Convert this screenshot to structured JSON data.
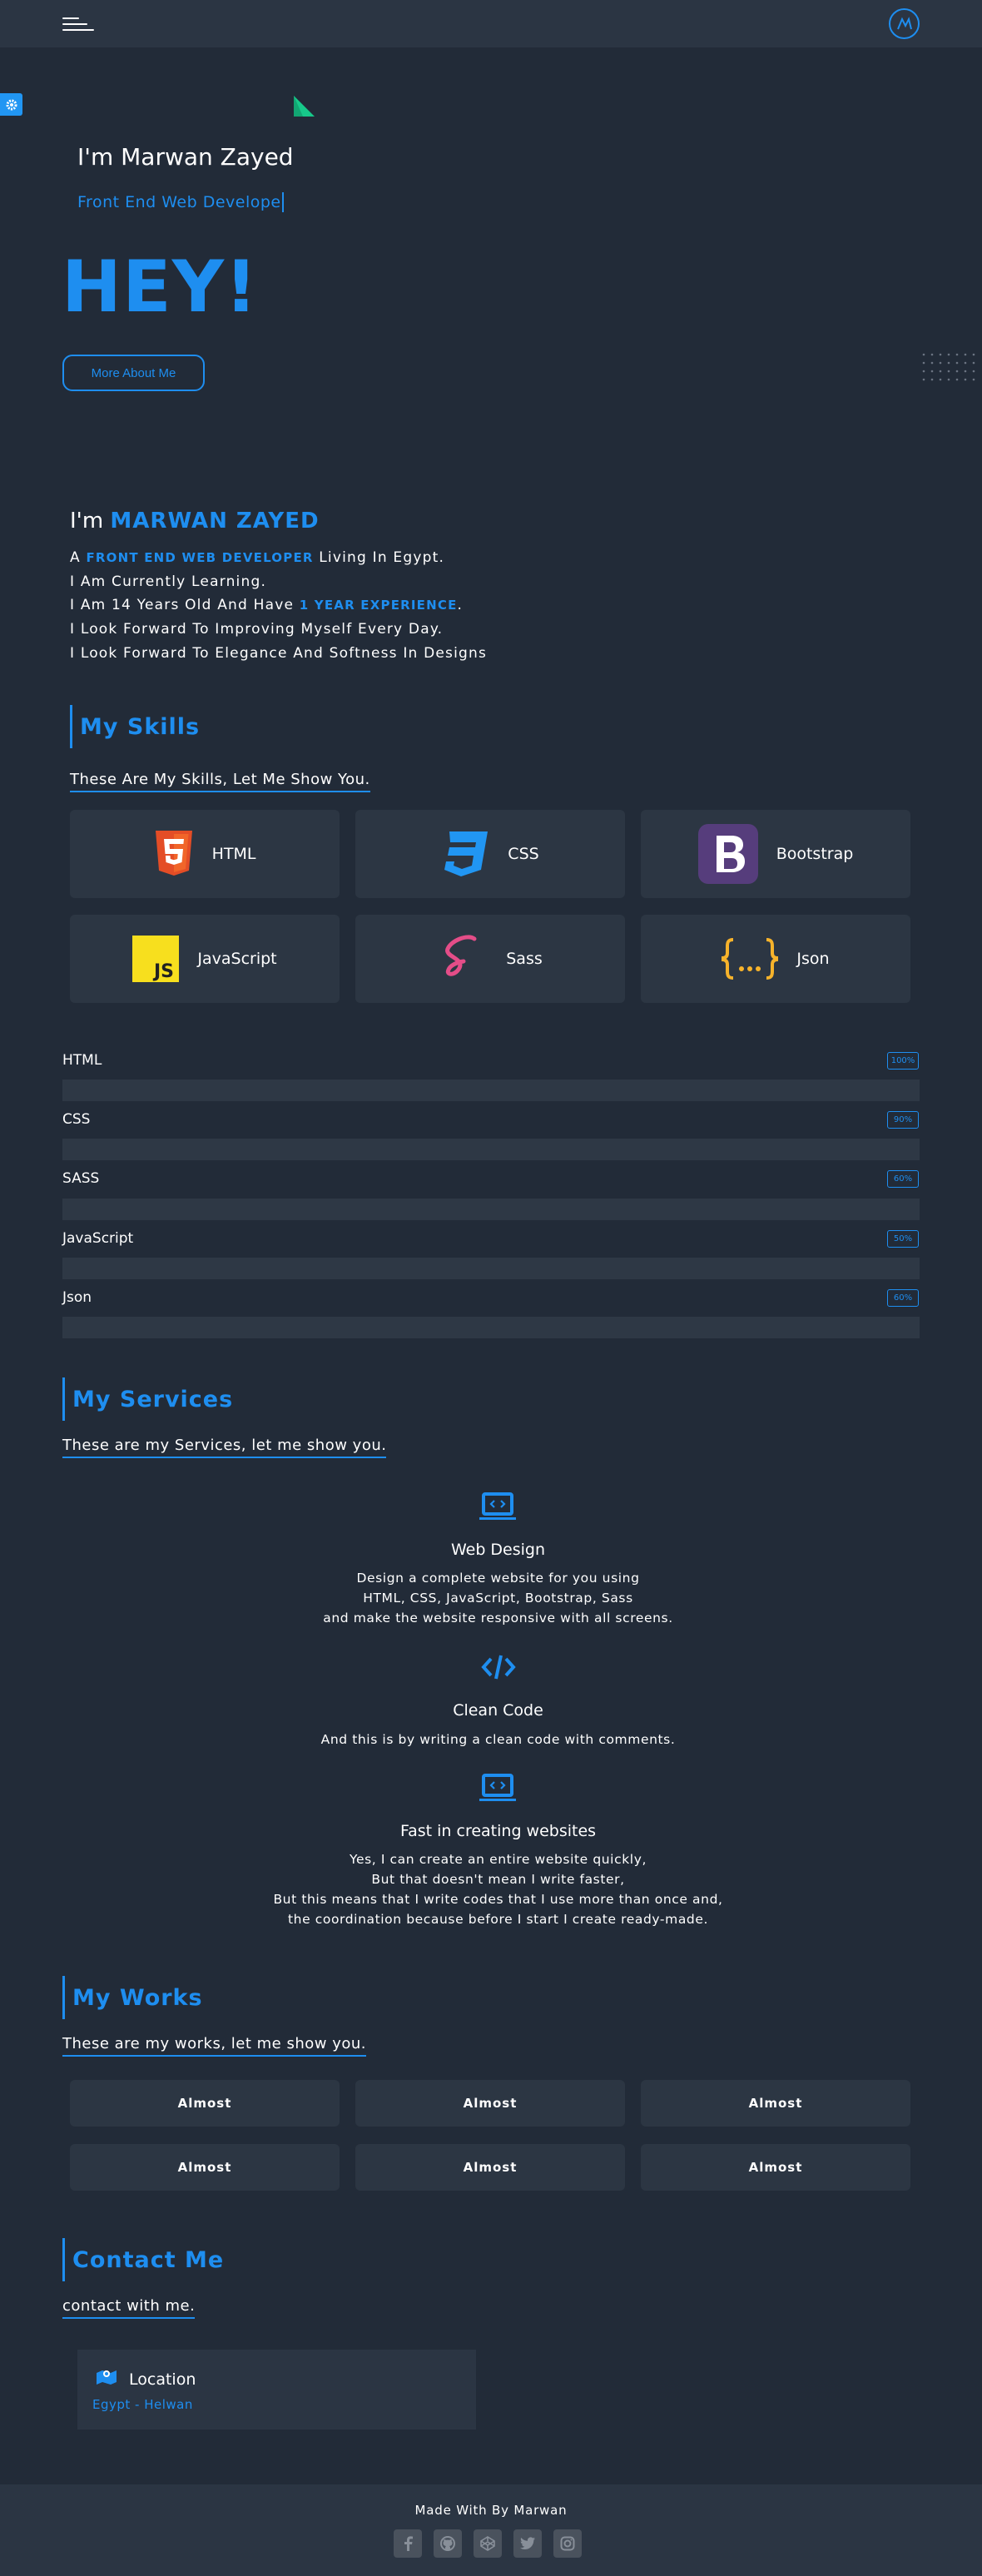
{
  "hero": {
    "greeting": "I'm Marwan Zayed",
    "typed_role": "Front End Web Develope",
    "hey": "HEY!",
    "more_button": "More About Me"
  },
  "about": {
    "prefix": "I'm",
    "name": "MARWAN ZAYED",
    "line1_a": "A",
    "line1_role": "FRONT END WEB DEVELOPER",
    "line1_b": "Living In Egypt.",
    "line2": "I Am Currently Learning.",
    "line3_a": "I Am 14 Years Old And Have",
    "line3_exp": "1 YEAR EXPERIENCE",
    "line3_b": ".",
    "line4": "I Look Forward To Improving Myself Every Day.",
    "line5": "I Look Forward To Elegance And Softness In Designs"
  },
  "skills": {
    "title": "My Skills",
    "subtitle": "These Are My Skills, Let Me Show You.",
    "cards": [
      {
        "label": "HTML",
        "icon": "html5-icon",
        "color": "#e44d26"
      },
      {
        "label": "CSS",
        "icon": "css3-icon",
        "color": "#2196f3"
      },
      {
        "label": "Bootstrap",
        "icon": "bootstrap-icon",
        "color": "#563d7c"
      },
      {
        "label": "JavaScript",
        "icon": "js-icon",
        "color": "#f7df1e"
      },
      {
        "label": "Sass",
        "icon": "sass-icon",
        "color": "#e44d88"
      },
      {
        "label": "Json",
        "icon": "json-icon",
        "color": "#f7b32b"
      }
    ]
  },
  "bars": [
    {
      "label": "HTML",
      "pct": "100%",
      "value": 100
    },
    {
      "label": "CSS",
      "pct": "90%",
      "value": 90
    },
    {
      "label": "SASS",
      "pct": "60%",
      "value": 60
    },
    {
      "label": "JavaScript",
      "pct": "50%",
      "value": 50
    },
    {
      "label": "Json",
      "pct": "60%",
      "value": 60
    }
  ],
  "services": {
    "title": "My Services",
    "subtitle": "These are my Services, let me show you.",
    "items": [
      {
        "title": "Web Design",
        "desc1": "Design a complete website for you using",
        "desc2": "HTML, CSS, JavaScript, Bootstrap, Sass",
        "desc3": "and make the website responsive with all screens."
      },
      {
        "title": "Clean Code",
        "desc1": "And this is by writing a clean code with comments."
      },
      {
        "title": "Fast in creating websites",
        "desc1": "Yes, I can create an entire website quickly,",
        "desc2": "But that doesn't mean I write faster,",
        "desc3": "But this means that I write codes that I use more than once and,",
        "desc4": "the coordination because before I start I create ready-made."
      }
    ]
  },
  "works": {
    "title": "My Works",
    "subtitle": "These are my works, let me show you.",
    "items": [
      "Almost",
      "Almost",
      "Almost",
      "Almost",
      "Almost",
      "Almost"
    ]
  },
  "contact": {
    "title": "Contact Me",
    "subtitle": "contact with me.",
    "location_label": "Location",
    "location_value": "Egypt - Helwan"
  },
  "footer": {
    "text": "Made With By Marwan",
    "socials": [
      "facebook-icon",
      "github-icon",
      "codepen-icon",
      "twitter-icon",
      "instagram-icon"
    ]
  },
  "colors": {
    "accent": "#1e8ef0",
    "bg": "#222b38",
    "panel": "#2c3643"
  }
}
